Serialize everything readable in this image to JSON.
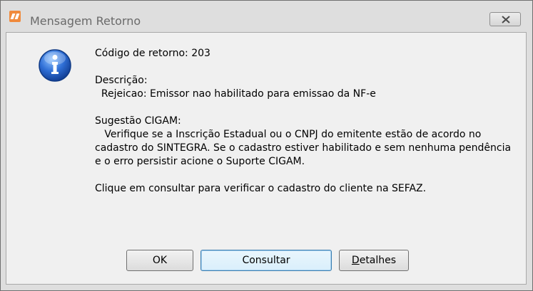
{
  "window": {
    "title": "Mensagem Retorno",
    "icon": "cigam-app-icon",
    "close_icon": "close-icon"
  },
  "message": {
    "icon": "info-icon",
    "code_line": "Código de retorno: 203",
    "description_label": "Descrição:",
    "description_text": "  Rejeicao: Emissor nao habilitado para emissao da NF-e",
    "suggestion_label": "Sugestão CIGAM:",
    "suggestion_lines": [
      "   Verifique se a Inscrição Estadual ou o CNPJ do emitente estão de acordo no",
      "cadastro do SINTEGRA. Se o cadastro estiver habilitado e sem nenhuma pendência",
      "e o erro persistir acione o Suporte CIGAM."
    ],
    "consult_line": "Clique em consultar para verificar o cadastro do cliente na SEFAZ."
  },
  "buttons": {
    "ok": "OK",
    "consultar": "Consultar",
    "detalhes_first": "D",
    "detalhes_rest": "etalhes"
  }
}
